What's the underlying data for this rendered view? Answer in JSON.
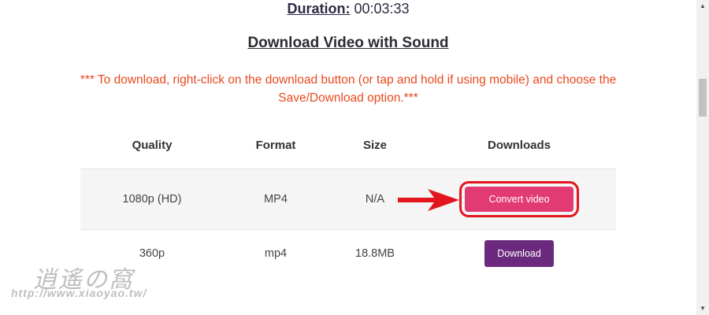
{
  "duration": {
    "label": "Duration:",
    "value": "00:03:33"
  },
  "section_title": "Download Video with Sound",
  "note": {
    "line1": "*** To download, right-click on the download button (or tap and hold if using mobile) and choose the",
    "line2": "Save/Download option.***"
  },
  "table": {
    "headers": [
      "Quality",
      "Format",
      "Size",
      "Downloads"
    ],
    "rows": [
      {
        "quality": "1080p (HD)",
        "format": "MP4",
        "size": "N/A",
        "button": "Convert video"
      },
      {
        "quality": "360p",
        "format": "mp4",
        "size": "18.8MB",
        "button": "Download"
      }
    ]
  },
  "colors": {
    "note": "#e8491d",
    "convert_button": "#e23b74",
    "download_button": "#6c2a7e",
    "highlight": "#e3151d"
  },
  "watermark": {
    "glyphs": "逍遙の窩",
    "url": "http://www.xiaoyao.tw/"
  },
  "icons": {
    "arrow": "red-arrow-icon",
    "scroll_up": "scroll-up-arrow-icon",
    "scroll_down": "scroll-down-arrow-icon"
  }
}
